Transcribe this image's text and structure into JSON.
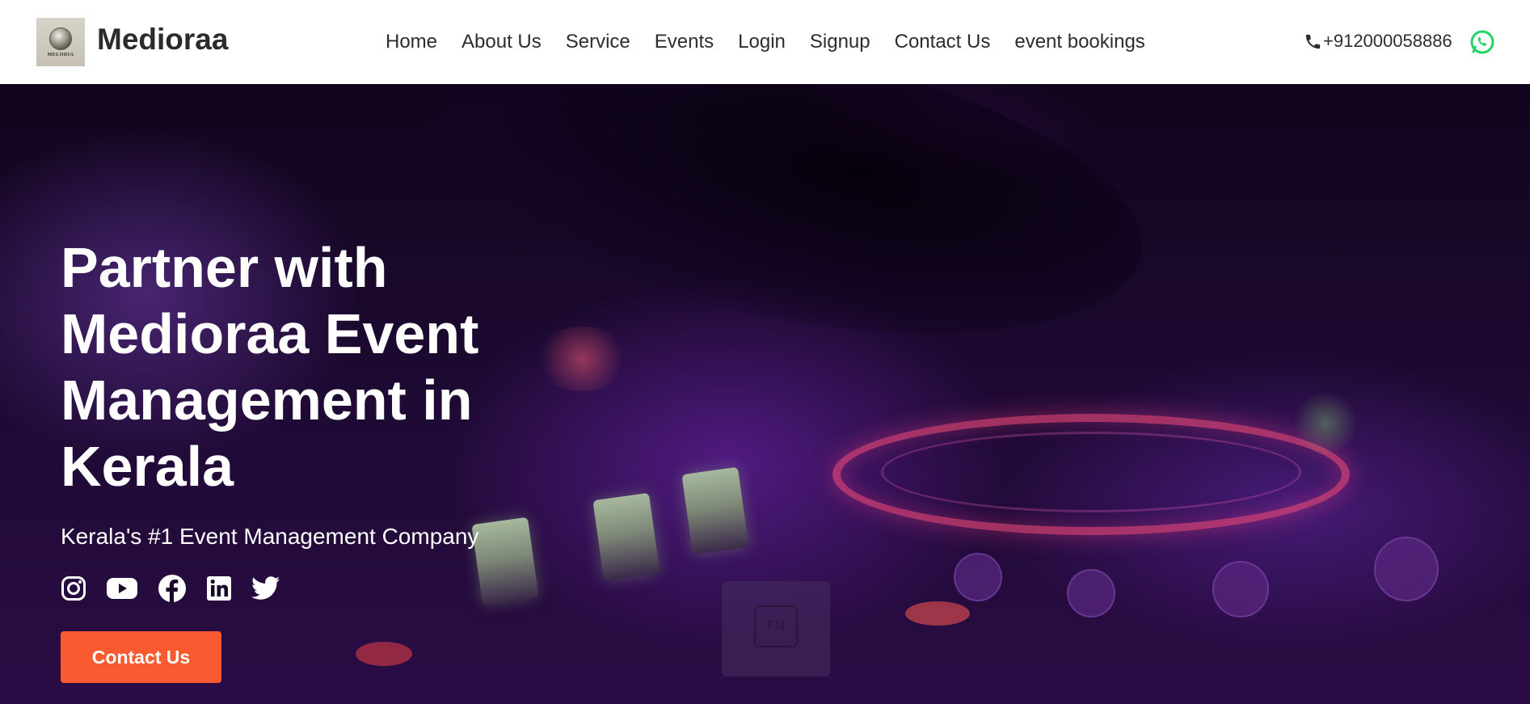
{
  "brand": {
    "name": "Medioraa",
    "logo_text": "MELODIA"
  },
  "nav": {
    "items": [
      {
        "label": "Home"
      },
      {
        "label": "About Us"
      },
      {
        "label": "Service"
      },
      {
        "label": "Events"
      },
      {
        "label": "Login"
      },
      {
        "label": "Signup"
      },
      {
        "label": "Contact Us"
      },
      {
        "label": "event bookings"
      }
    ],
    "phone": "+912000058886",
    "phone_icon": "phone-icon",
    "whatsapp_icon": "whatsapp-icon"
  },
  "hero": {
    "title": "Partner with Medioraa Event Management in Kerala",
    "subtitle": "Kerala's #1 Event Management Company",
    "cta_label": "Contact Us",
    "socials": [
      "instagram-icon",
      "youtube-icon",
      "facebook-icon",
      "linkedin-icon",
      "twitter-icon"
    ],
    "overlay_key": "FN"
  },
  "colors": {
    "cta": "#fa5a2f",
    "whatsapp": "#25d366",
    "nav_text": "#2d2d2d",
    "hero_bg": "#1f0a35"
  }
}
